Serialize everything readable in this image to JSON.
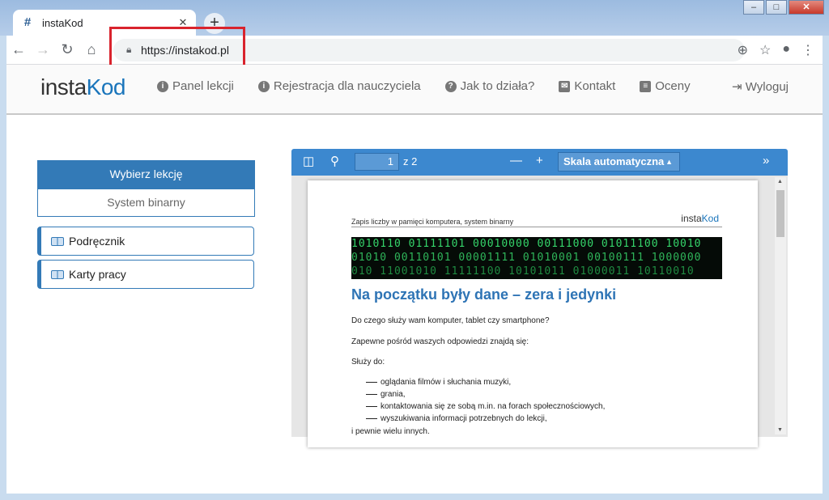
{
  "browser": {
    "tab_title": "instaKod",
    "tab_favicon": "#",
    "tab_close": "✕",
    "new_tab": "+",
    "url": "https://instakod.pl",
    "window_buttons": [
      "–",
      "□",
      "✕"
    ]
  },
  "site": {
    "logo_part1": "insta",
    "logo_part2": "Kod",
    "nav": [
      {
        "label": "Panel lekcji",
        "icon": "info-circle-icon",
        "glyph": "i"
      },
      {
        "label": "Rejestracja dla nauczyciela",
        "icon": "info-circle-icon",
        "glyph": "i"
      },
      {
        "label": "Jak to działa?",
        "icon": "question-circle-icon",
        "glyph": "?"
      },
      {
        "label": "Kontakt",
        "icon": "envelope-icon",
        "glyph": "✉"
      },
      {
        "label": "Oceny",
        "icon": "list-icon",
        "glyph": "≡"
      }
    ],
    "logout": "Wyloguj"
  },
  "sidebar": {
    "choose_lesson": "Wybierz lekcję",
    "selected_lesson": "System binarny",
    "buttons": [
      "Podręcznik",
      "Karty pracy"
    ]
  },
  "pdf": {
    "page_current": "1",
    "page_count": "z 2",
    "scale": "Skala automatyczna",
    "doc_subtitle": "Zapis liczby w pamięci komputera, system binarny",
    "doc_logo_part1": "insta",
    "doc_logo_part2": "Kod",
    "banner_lines": [
      "1010110 01111101 00010000 00111000 01011100 10010",
      "01010 00110101 00001111 01010001 00100111 1000000",
      "010 11001010 11111100 10101011 01000011 10110010"
    ],
    "doc_title": "Na początku były dane – zera i jedynki",
    "paragraphs": [
      "Do czego służy wam komputer, tablet czy smartphone?",
      "Zapewne pośród waszych odpowiedzi znajdą się:",
      "Służy do:"
    ],
    "list": [
      "oglądania filmów i słuchania muzyki,",
      "grania,",
      "kontaktowania się ze sobą m.in. na forach społecznościowych,",
      "wyszukiwania informacji potrzebnych do lekcji,"
    ],
    "closing": "i pewnie wielu innych."
  },
  "colors": {
    "primary": "#337ab7",
    "pdf_bar": "#3c88cf",
    "highlight": "#d9232d",
    "doc_title": "#2e74b5"
  }
}
